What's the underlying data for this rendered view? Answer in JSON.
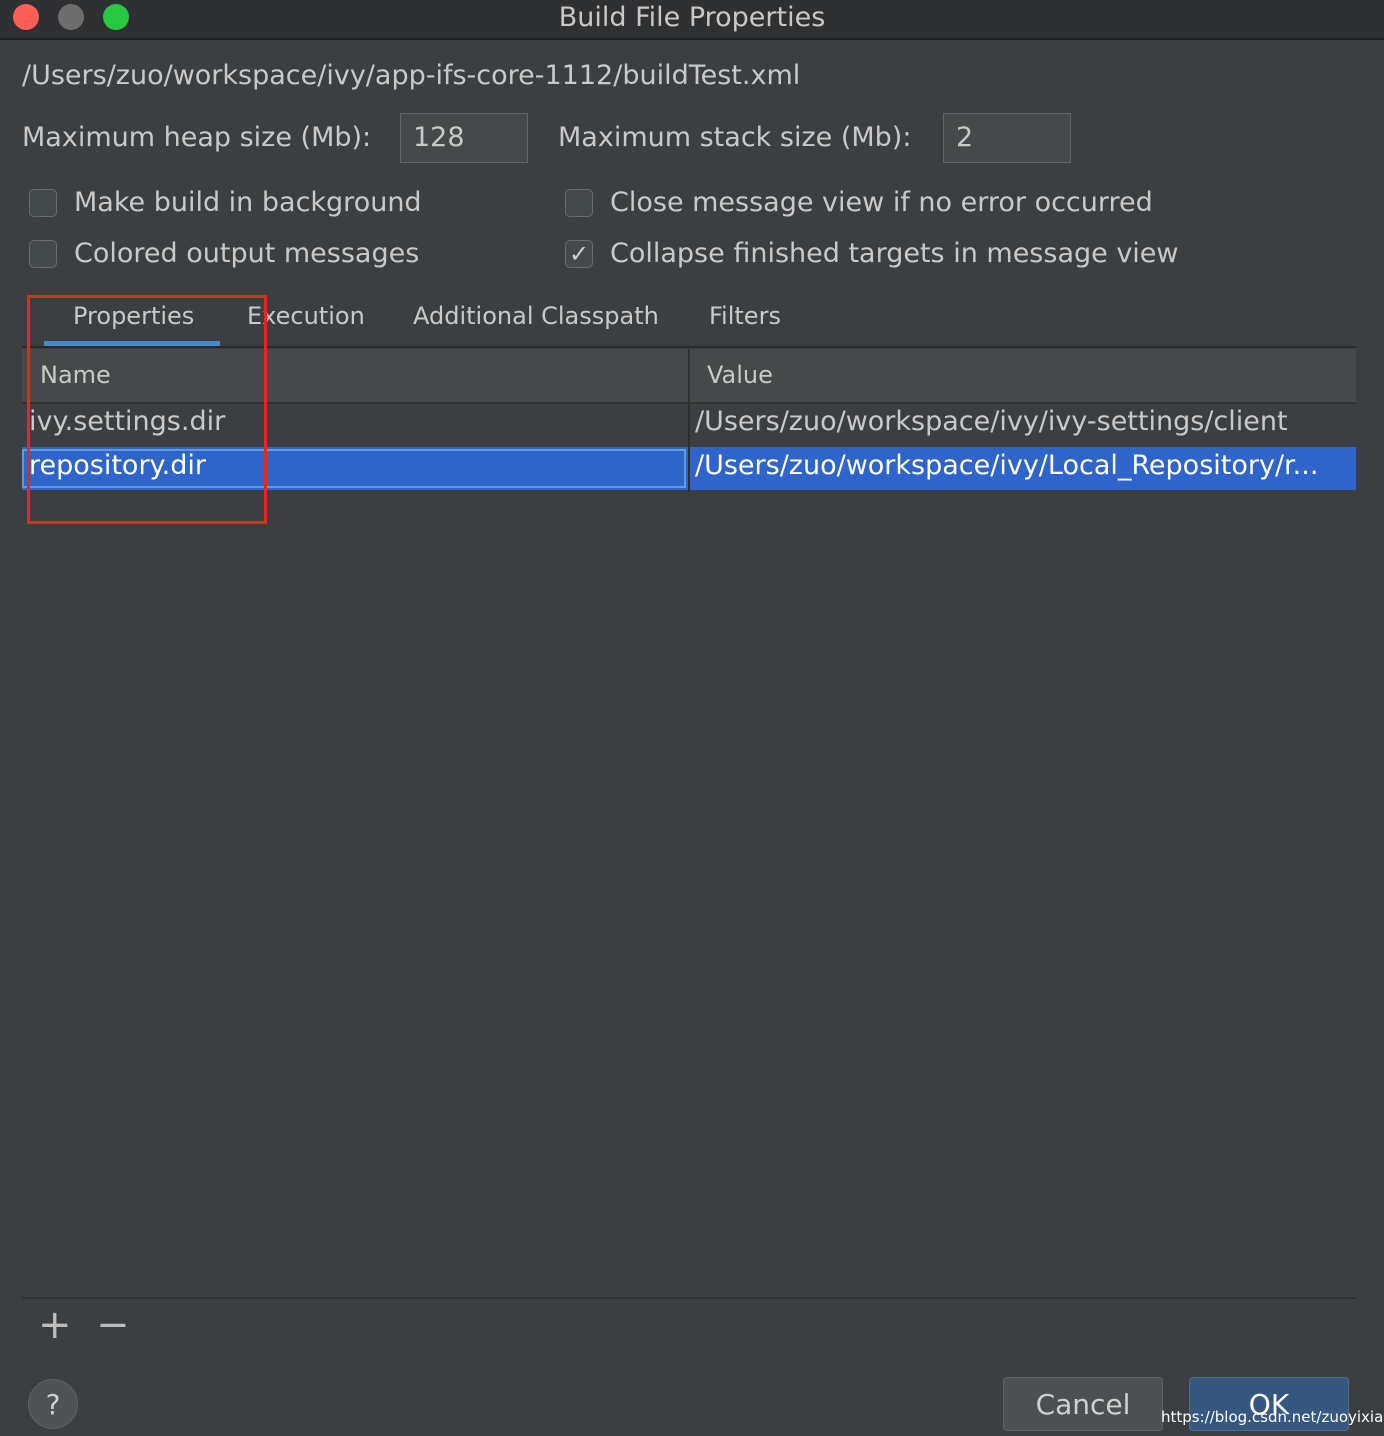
{
  "window": {
    "title": "Build File Properties"
  },
  "file_path": "/Users/zuo/workspace/ivy/app-ifs-core-1112/buildTest.xml",
  "heap": {
    "label": "Maximum heap size (Mb):",
    "value": "128"
  },
  "stack": {
    "label": "Maximum stack size (Mb):",
    "value": "2"
  },
  "options": {
    "make_background": {
      "label": "Make build in background",
      "checked": false
    },
    "colored_output": {
      "label": "Colored output messages",
      "checked": false
    },
    "close_message": {
      "label": "Close message view if no error occurred",
      "checked": false
    },
    "collapse_targets": {
      "label": "Collapse finished targets in message view",
      "checked": true,
      "mark": "✓"
    }
  },
  "tabs": [
    {
      "label": "Properties",
      "active": true
    },
    {
      "label": "Execution",
      "active": false
    },
    {
      "label": "Additional Classpath",
      "active": false
    },
    {
      "label": "Filters",
      "active": false
    }
  ],
  "table": {
    "columns": [
      "Name",
      "Value"
    ],
    "rows": [
      {
        "name": "ivy.settings.dir",
        "value": "/Users/zuo/workspace/ivy/ivy-settings/client",
        "selected": false
      },
      {
        "name": "repository.dir",
        "value": "/Users/zuo/workspace/ivy/Local_Repository/r...",
        "selected": true
      }
    ]
  },
  "toolbar": {
    "add": "+",
    "remove": "−"
  },
  "buttons": {
    "help": "?",
    "cancel": "Cancel",
    "ok": "OK"
  },
  "watermark": "https://blog.csdn.net/zuoyixiao",
  "colors": {
    "selection": "#2f65ca",
    "accent": "#4a88c7",
    "annotation": "#e6281c"
  }
}
